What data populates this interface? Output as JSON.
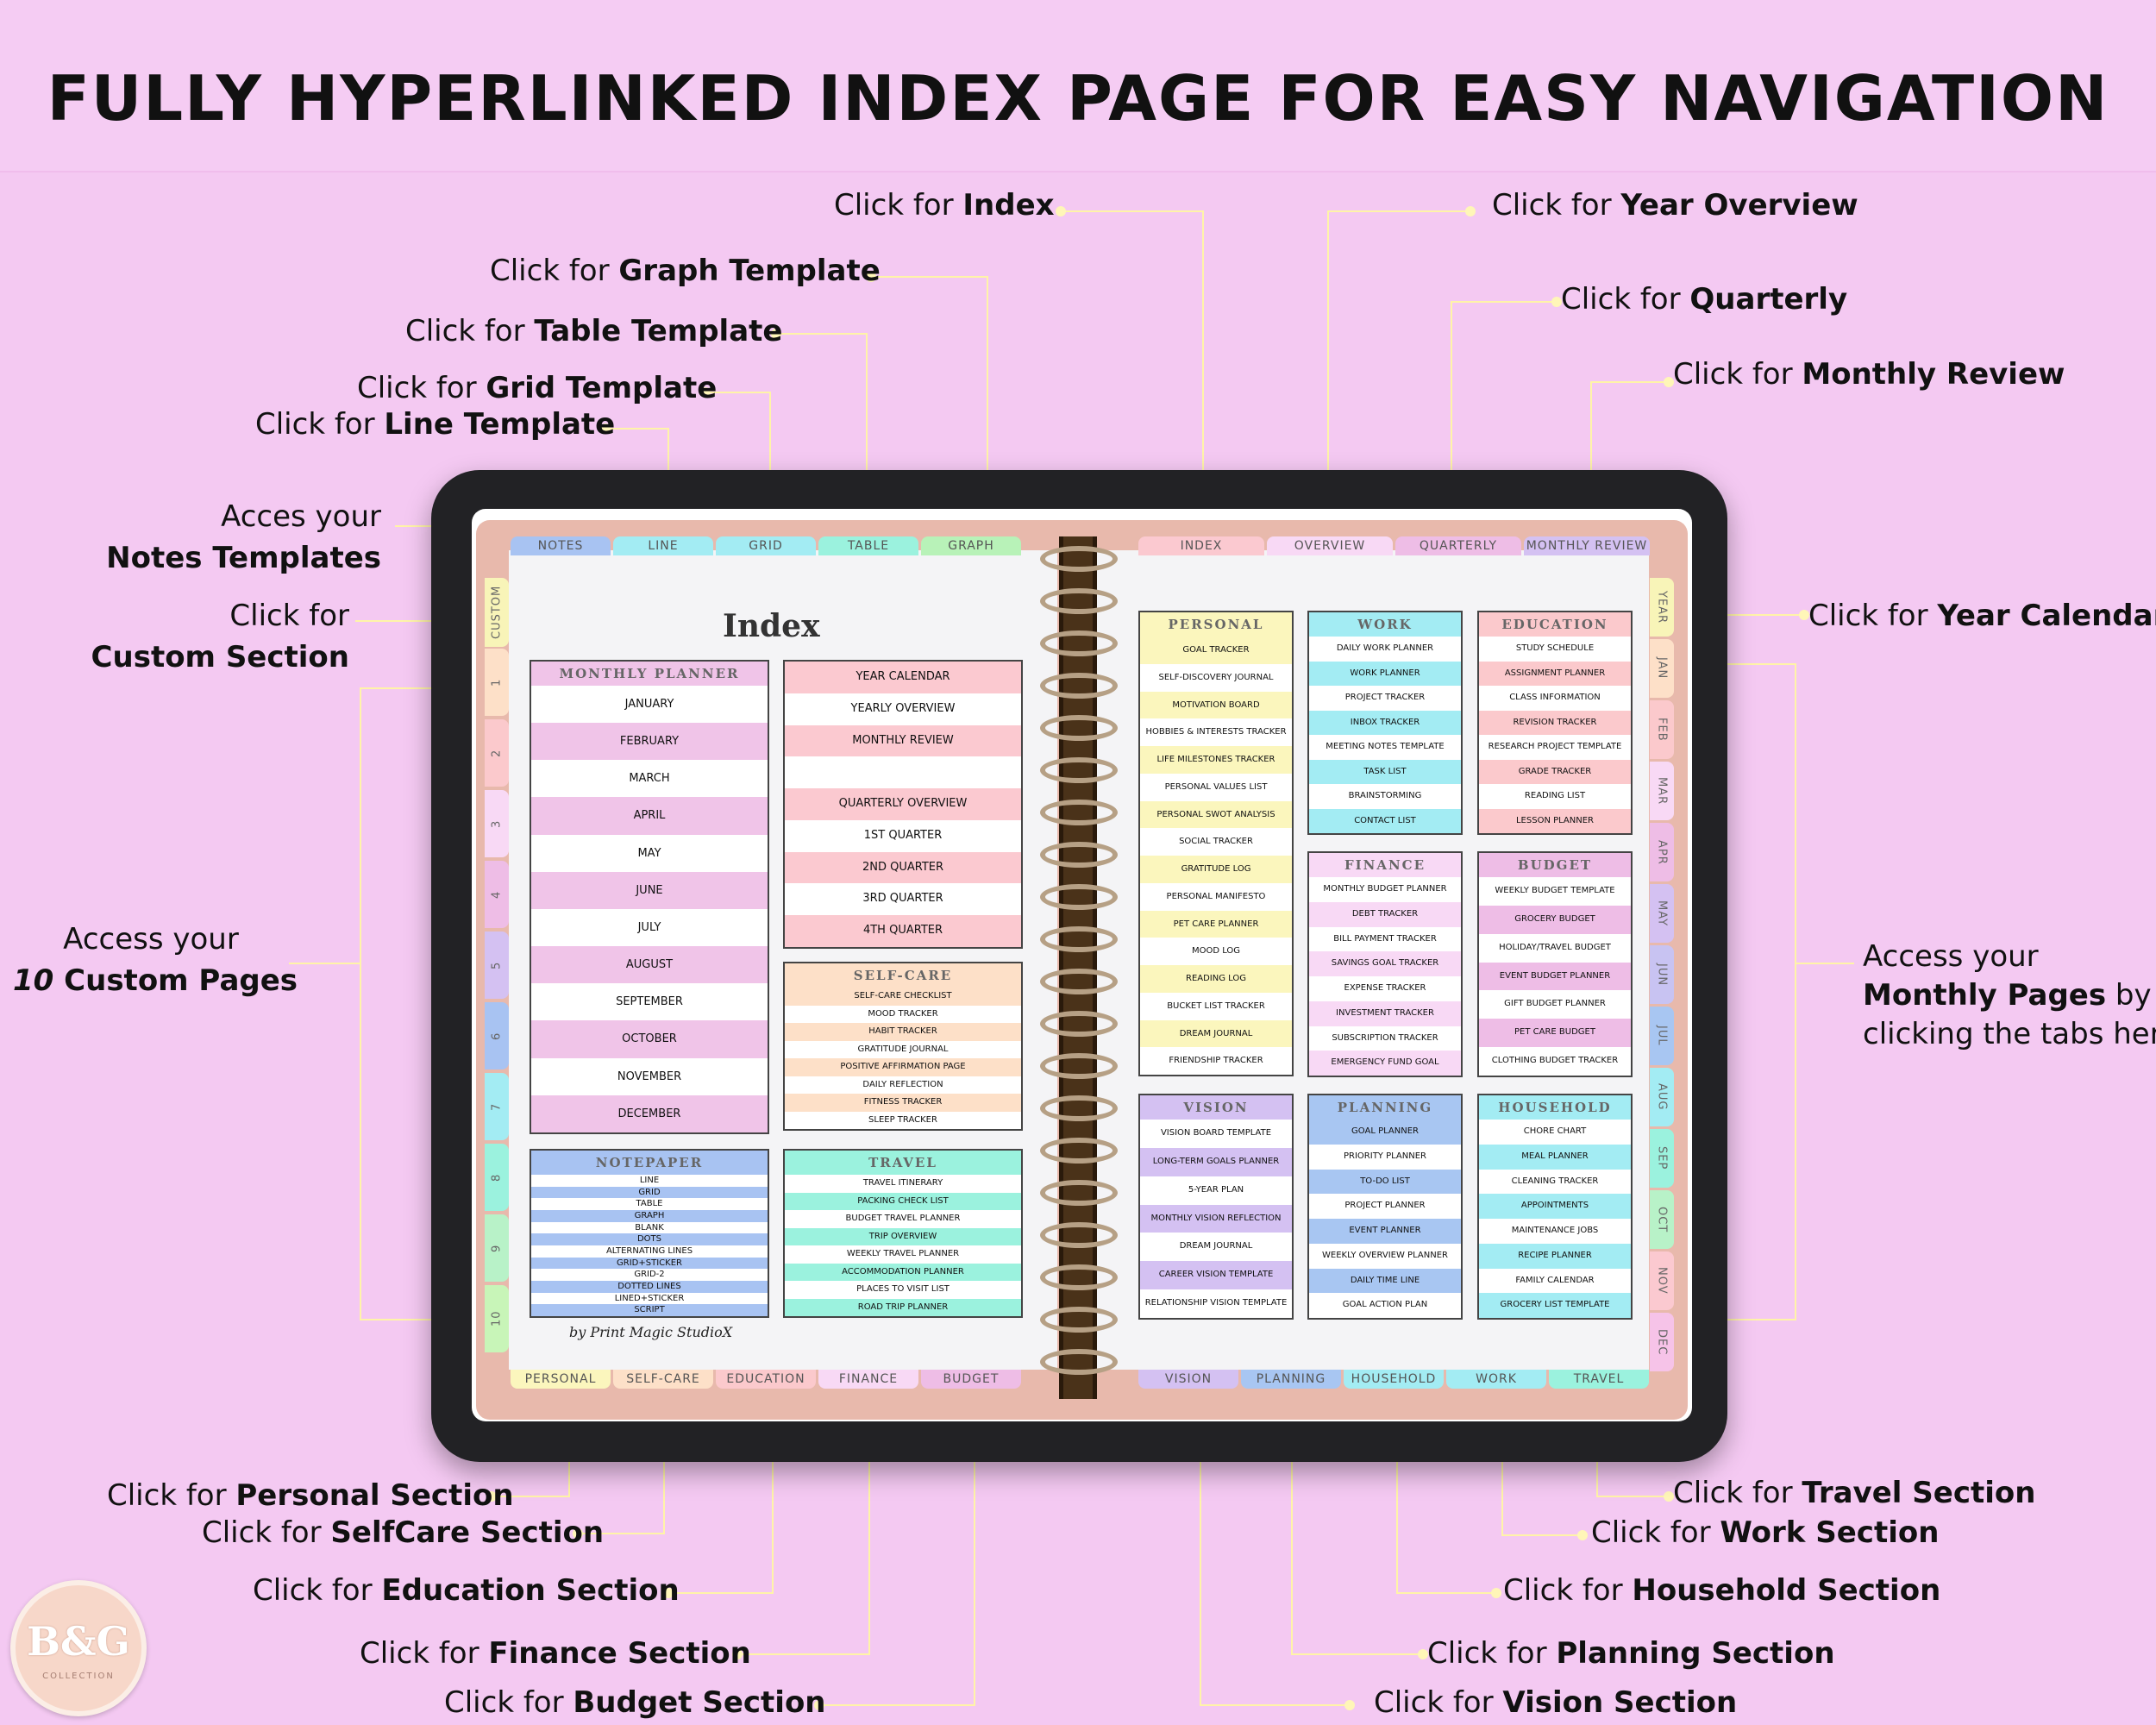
{
  "header": {
    "title": "FULLY HYPERLINKED INDEX PAGE FOR EASY NAVIGATION"
  },
  "annotations": {
    "index": {
      "pre": "Click for ",
      "bold": "Index"
    },
    "year_overview": {
      "pre": "Click for ",
      "bold": "Year Overview"
    },
    "graph": {
      "pre": "Click for ",
      "bold": "Graph Template"
    },
    "quarterly": {
      "pre": "Click for ",
      "bold": "Quarterly"
    },
    "table": {
      "pre": "Click for ",
      "bold": "Table Template"
    },
    "monthly_review": {
      "pre": "Click for ",
      "bold": "Monthly Review"
    },
    "grid": {
      "pre": "Click for ",
      "bold": "Grid Template"
    },
    "line": {
      "pre": "Click for ",
      "bold": "Line Template"
    },
    "notes": {
      "pre": "Acces your",
      "bold": "Notes Templates"
    },
    "custom": {
      "pre": "Click for",
      "bold": "Custom Section"
    },
    "year_calendar": {
      "pre": "Click for ",
      "bold": "Year Calendar"
    },
    "custom_pages": {
      "pre": "Access your",
      "bold_num": "10",
      "bold": " Custom Pages"
    },
    "monthly_pages": {
      "pre": "Access your",
      "bold": "Monthly Pages",
      "post": " by",
      "post2": "clicking the tabs here"
    },
    "personal": {
      "pre": "Click for ",
      "bold": "Personal Section"
    },
    "selfcare": {
      "pre": "Click for ",
      "bold": "SelfCare Section"
    },
    "education": {
      "pre": "Click for ",
      "bold": "Education Section"
    },
    "finance": {
      "pre": "Click for ",
      "bold": "Finance Section"
    },
    "budget": {
      "pre": "Click for ",
      "bold": "Budget Section"
    },
    "travel": {
      "pre": "Click for ",
      "bold": "Travel Section"
    },
    "work": {
      "pre": "Click for ",
      "bold": "Work Section"
    },
    "household": {
      "pre": "Click for ",
      "bold": "Household Section"
    },
    "planning": {
      "pre": "Click for ",
      "bold": "Planning Section"
    },
    "vision": {
      "pre": "Click for ",
      "bold": "Vision Section"
    }
  },
  "top_tabs_left": [
    "NOTES",
    "LINE",
    "GRID",
    "TABLE",
    "GRAPH"
  ],
  "top_tabs_right": [
    "INDEX",
    "OVERVIEW",
    "QUARTERLY",
    "MONTHLY REVIEW"
  ],
  "bottom_tabs_left": [
    "PERSONAL",
    "SELF-CARE",
    "EDUCATION",
    "FINANCE",
    "BUDGET"
  ],
  "bottom_tabs_right": [
    "VISION",
    "PLANNING",
    "HOUSEHOLD",
    "WORK",
    "TRAVEL"
  ],
  "left_side_tabs": [
    "CUSTOM",
    "1",
    "2",
    "3",
    "4",
    "5",
    "6",
    "7",
    "8",
    "9",
    "10"
  ],
  "right_side_tabs": [
    "YEAR",
    "JAN",
    "FEB",
    "MAR",
    "APR",
    "MAY",
    "JUN",
    "JUL",
    "AUG",
    "SEP",
    "OCT",
    "NOV",
    "DEC"
  ],
  "index_title": "Index",
  "signature": "by Print Magic StudioX",
  "logo": {
    "main": "B&G",
    "sub": "COLLECTION"
  },
  "colors": {
    "background": "#f4c9f2",
    "monthly": "#f0c4e8",
    "overview": "#fbc9d0",
    "selfcare": "#fde0c8",
    "notepaper": "#a8c3f2",
    "travel": "#9bf2de",
    "personal": "#fbf6bd",
    "work": "#a3ecf3",
    "education": "#fbc9cc",
    "finance": "#f8d9f5",
    "budget": "#eebde6",
    "vision": "#d4c1f2",
    "planning": "#a8c6f2",
    "household": "#a3ecf3"
  },
  "sections": {
    "monthly": {
      "title": "MONTHLY PLANNER",
      "items": [
        "JANUARY",
        "FEBRUARY",
        "MARCH",
        "APRIL",
        "MAY",
        "JUNE",
        "JULY",
        "AUGUST",
        "SEPTEMBER",
        "OCTOBER",
        "NOVEMBER",
        "DECEMBER"
      ]
    },
    "overview": {
      "title": "",
      "items": [
        "YEAR CALENDAR",
        "YEARLY OVERVIEW",
        "MONTHLY REVIEW",
        "",
        "QUARTERLY OVERVIEW",
        "1ST QUARTER",
        "2ND QUARTER",
        "3RD QUARTER",
        "4TH QUARTER"
      ]
    },
    "selfcare": {
      "title": "SELF-CARE",
      "items": [
        "SELF-CARE CHECKLIST",
        "MOOD TRACKER",
        "HABIT TRACKER",
        "GRATITUDE JOURNAL",
        "POSITIVE AFFIRMATION PAGE",
        "DAILY REFLECTION",
        "FITNESS TRACKER",
        "SLEEP TRACKER"
      ]
    },
    "notepaper": {
      "title": "NOTEPAPER",
      "items": [
        "LINE",
        "GRID",
        "TABLE",
        "GRAPH",
        "BLANK",
        "DOTS",
        "ALTERNATING LINES",
        "GRID+STICKER",
        "GRID-2",
        "DOTTED LINES",
        "LINED+STICKER",
        "SCRIPT"
      ]
    },
    "travel": {
      "title": "TRAVEL",
      "items": [
        "TRAVEL ITINERARY",
        "PACKING CHECK LIST",
        "BUDGET TRAVEL PLANNER",
        "TRIP OVERVIEW",
        "WEEKLY TRAVEL PLANNER",
        "ACCOMMODATION PLANNER",
        "PLACES TO VISIT LIST",
        "ROAD TRIP PLANNER"
      ]
    },
    "personal": {
      "title": "PERSONAL",
      "items": [
        "GOAL TRACKER",
        "SELF-DISCOVERY JOURNAL",
        "MOTIVATION BOARD",
        "HOBBIES & INTERESTS TRACKER",
        "LIFE MILESTONES TRACKER",
        "PERSONAL VALUES LIST",
        "PERSONAL SWOT ANALYSIS",
        "SOCIAL TRACKER",
        "GRATITUDE LOG",
        "PERSONAL MANIFESTO",
        "PET CARE PLANNER",
        "MOOD LOG",
        "READING LOG",
        "BUCKET LIST TRACKER",
        "DREAM JOURNAL",
        "FRIENDSHIP TRACKER"
      ]
    },
    "work": {
      "title": "WORK",
      "items": [
        "DAILY WORK PLANNER",
        "WORK PLANNER",
        "PROJECT TRACKER",
        "INBOX TRACKER",
        "MEETING NOTES TEMPLATE",
        "TASK LIST",
        "BRAINSTORMING",
        "CONTACT LIST"
      ]
    },
    "education": {
      "title": "EDUCATION",
      "items": [
        "STUDY SCHEDULE",
        "ASSIGNMENT PLANNER",
        "CLASS INFORMATION",
        "REVISION TRACKER",
        "RESEARCH PROJECT TEMPLATE",
        "GRADE TRACKER",
        "READING LIST",
        "LESSON PLANNER"
      ]
    },
    "finance": {
      "title": "FINANCE",
      "items": [
        "MONTHLY BUDGET PLANNER",
        "DEBT TRACKER",
        "BILL PAYMENT TRACKER",
        "SAVINGS GOAL TRACKER",
        "EXPENSE TRACKER",
        "INVESTMENT TRACKER",
        "SUBSCRIPTION TRACKER",
        "EMERGENCY FUND GOAL"
      ]
    },
    "budget": {
      "title": "BUDGET",
      "items": [
        "WEEKLY BUDGET TEMPLATE",
        "GROCERY BUDGET",
        "HOLIDAY/TRAVEL BUDGET",
        "EVENT BUDGET PLANNER",
        "GIFT BUDGET PLANNER",
        "PET CARE BUDGET",
        "CLOTHING BUDGET TRACKER"
      ]
    },
    "vision": {
      "title": "VISION",
      "items": [
        "VISION BOARD TEMPLATE",
        "LONG-TERM GOALS PLANNER",
        "5-YEAR PLAN",
        "MONTHLY VISION REFLECTION",
        "DREAM JOURNAL",
        "CAREER VISION TEMPLATE",
        "RELATIONSHIP VISION TEMPLATE"
      ]
    },
    "planning": {
      "title": "PLANNING",
      "items": [
        "GOAL PLANNER",
        "PRIORITY PLANNER",
        "TO-DO LIST",
        "PROJECT PLANNER",
        "EVENT PLANNER",
        "WEEKLY OVERVIEW PLANNER",
        "DAILY TIME LINE",
        "GOAL ACTION PLAN"
      ]
    },
    "household": {
      "title": "HOUSEHOLD",
      "items": [
        "CHORE CHART",
        "MEAL PLANNER",
        "CLEANING TRACKER",
        "APPOINTMENTS",
        "MAINTENANCE JOBS",
        "RECIPE PLANNER",
        "FAMILY CALENDAR",
        "GROCERY LIST TEMPLATE"
      ]
    }
  }
}
